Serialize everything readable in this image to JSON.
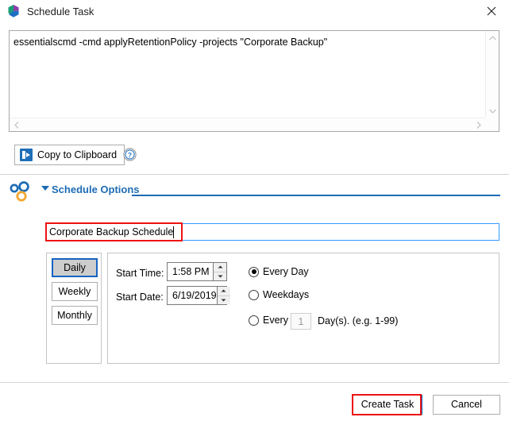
{
  "window": {
    "title": "Schedule Task",
    "app_icon": "app-logo-icon",
    "close_label": "✕"
  },
  "command": {
    "text": "essentialscmd -cmd applyRetentionPolicy -projects \"Corporate Backup\"",
    "vscroll_up": "scroll-up-icon",
    "vscroll_down": "scroll-down-icon",
    "hscroll_left": "scroll-left-icon",
    "hscroll_right": "scroll-right-icon"
  },
  "toolbar": {
    "copy_label": "Copy to Clipboard",
    "copy_icon": "clipboard-icon",
    "help_icon": "help-question-icon"
  },
  "section": {
    "title": "Schedule Options",
    "gear_icon": "gears-icon",
    "collapse_icon": "chevron-down-icon",
    "accent_color": "#1e6cb5"
  },
  "task_name": {
    "value": "Corporate Backup Schedule",
    "placeholder": ""
  },
  "frequency": {
    "options": [
      {
        "label": "Daily",
        "selected": true
      },
      {
        "label": "Weekly",
        "selected": false
      },
      {
        "label": "Monthly",
        "selected": false
      }
    ]
  },
  "schedule": {
    "start_time_label": "Start Time:",
    "start_time_value": "1:58 PM",
    "start_date_label": "Start Date:",
    "start_date_value": "6/19/2019",
    "recurrence": [
      {
        "label": "Every Day",
        "selected": true
      },
      {
        "label": "Weekdays",
        "selected": false
      },
      {
        "label": "Every",
        "selected": false
      }
    ],
    "every_interval_value": "1",
    "every_suffix": "Day(s). (e.g. 1-99)"
  },
  "footer": {
    "primary_label": "Create Task",
    "secondary_label": "Cancel"
  },
  "annotations": {
    "highlight_color": "#ee1111",
    "highlighted": [
      "task-name-input",
      "create-task-button"
    ]
  }
}
